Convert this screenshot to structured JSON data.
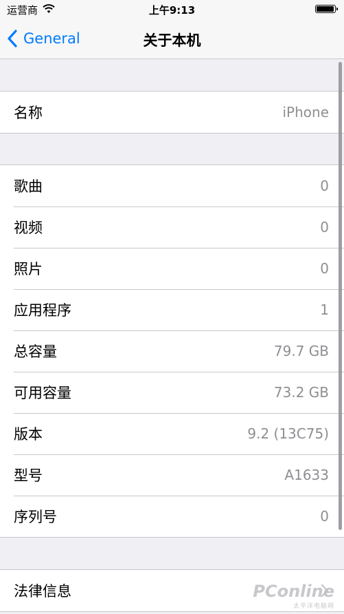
{
  "status": {
    "carrier": "运营商",
    "time": "上午9:13",
    "battery_level": 0.95
  },
  "nav": {
    "back_label": "General",
    "title": "关于本机"
  },
  "groups": {
    "name": [
      {
        "label": "名称",
        "value": "iPhone"
      }
    ],
    "info": [
      {
        "label": "歌曲",
        "value": "0"
      },
      {
        "label": "视频",
        "value": "0"
      },
      {
        "label": "照片",
        "value": "0"
      },
      {
        "label": "应用程序",
        "value": "1"
      },
      {
        "label": "总容量",
        "value": "79.7 GB"
      },
      {
        "label": "可用容量",
        "value": "73.2 GB"
      },
      {
        "label": "版本",
        "value": "9.2 (13C75)"
      },
      {
        "label": "型号",
        "value": "A1633"
      },
      {
        "label": "序列号",
        "value": "0"
      }
    ],
    "legal": [
      {
        "label": "法律信息"
      }
    ]
  },
  "watermark": {
    "main": "PConline",
    "sub": "太平洋电脑网"
  },
  "colors": {
    "accent": "#007aff",
    "background": "#efeff4",
    "separator": "#c8c7cc",
    "secondary_text": "#8e8e93"
  },
  "icons": [
    "wifi-icon",
    "battery-icon",
    "back-chevron-icon",
    "disclosure-chevron-icon"
  ]
}
